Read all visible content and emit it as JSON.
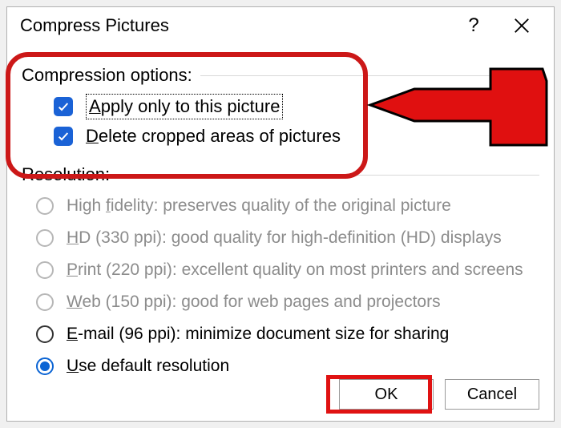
{
  "title": "Compress Pictures",
  "compression": {
    "label": "Compression options:",
    "apply_only": "Apply only to this picture",
    "delete_cropped": "Delete cropped areas of pictures"
  },
  "resolution": {
    "label": "Resolution:",
    "high_fidelity": "High fidelity: preserves quality of the original picture",
    "hd": "HD (330 ppi): good quality for high-definition (HD) displays",
    "print": "Print (220 ppi): excellent quality on most printers and screens",
    "web": "Web (150 ppi): good for web pages and projectors",
    "email": "E-mail (96 ppi): minimize document size for sharing",
    "default": "Use default resolution"
  },
  "buttons": {
    "ok": "OK",
    "cancel": "Cancel"
  }
}
